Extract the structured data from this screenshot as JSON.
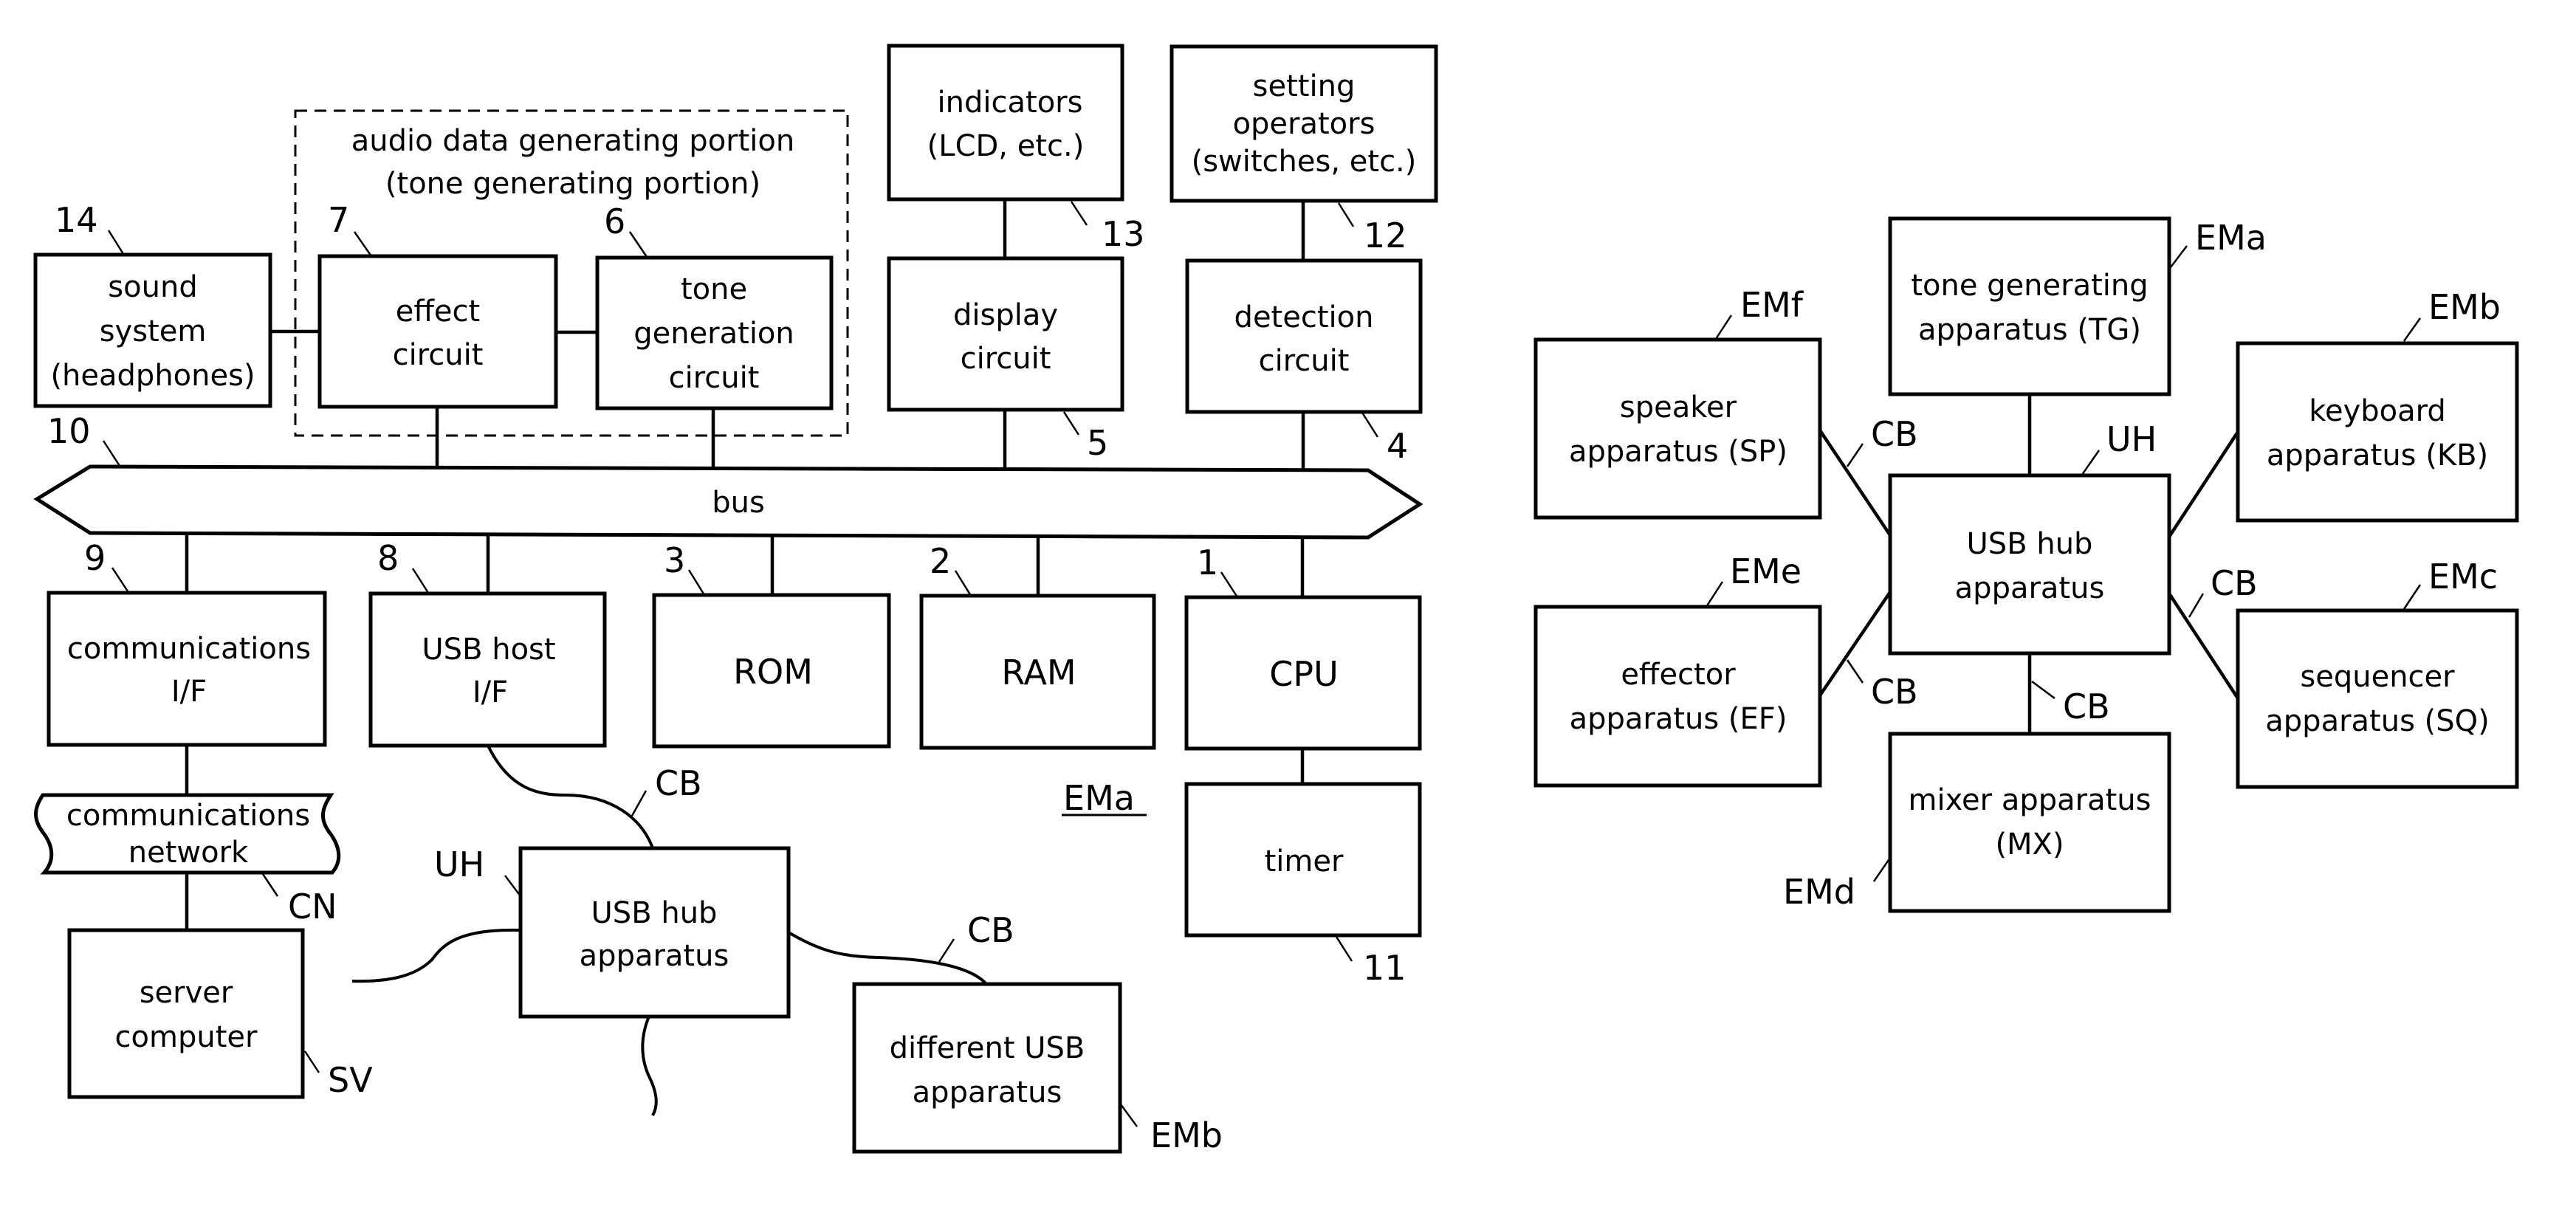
{
  "figure_left": {
    "group_title_line1": "audio data generating portion",
    "group_title_line2": "(tone generating portion)",
    "bus_label": "bus",
    "device_label": "EMa",
    "blocks": {
      "sound_system": [
        "sound",
        "system",
        "(headphones)"
      ],
      "effect_circuit": [
        "effect",
        "circuit"
      ],
      "tone_generation_circuit": [
        "tone",
        "generation",
        "circuit"
      ],
      "indicators": [
        "indicators",
        "(LCD, etc.)"
      ],
      "setting_operators": [
        "setting",
        "operators",
        "(switches, etc.)"
      ],
      "display_circuit": [
        "display",
        "circuit"
      ],
      "detection_circuit": [
        "detection",
        "circuit"
      ],
      "communications_if": [
        "communications",
        "I/F"
      ],
      "usb_host_if": [
        "USB host",
        "I/F"
      ],
      "rom": [
        "ROM"
      ],
      "ram": [
        "RAM"
      ],
      "cpu": [
        "CPU"
      ],
      "timer": [
        "timer"
      ],
      "communications_network": [
        "communications",
        "network"
      ],
      "server_computer": [
        "server",
        "computer"
      ],
      "usb_hub": [
        "USB hub",
        "apparatus"
      ],
      "different_usb": [
        "different USB",
        "apparatus"
      ]
    },
    "refs": {
      "r14": "14",
      "r7": "7",
      "r6": "6",
      "r13": "13",
      "r12": "12",
      "r5": "5",
      "r4": "4",
      "r10": "10",
      "r9": "9",
      "r8": "8",
      "r3": "3",
      "r2": "2",
      "r1": "1",
      "r11": "11",
      "cn": "CN",
      "sv": "SV",
      "uh": "UH",
      "cb1": "CB",
      "cb2": "CB",
      "emb": "EMb"
    }
  },
  "figure_right": {
    "blocks": {
      "tone_generating": [
        "tone generating",
        "apparatus (TG)"
      ],
      "speaker": [
        "speaker",
        "apparatus (SP)"
      ],
      "keyboard": [
        "keyboard",
        "apparatus (KB)"
      ],
      "usb_hub": [
        "USB hub",
        "apparatus"
      ],
      "effector": [
        "effector",
        "apparatus (EF)"
      ],
      "sequencer": [
        "sequencer",
        "apparatus (SQ)"
      ],
      "mixer": [
        "mixer apparatus",
        "(MX)"
      ]
    },
    "refs": {
      "ema": "EMa",
      "emf": "EMf",
      "emb": "EMb",
      "eme": "EMe",
      "emc": "EMc",
      "emd": "EMd",
      "uh": "UH",
      "cb_sp": "CB",
      "cb_ef": "CB",
      "cb_kbsq": "CB",
      "cb_mx": "CB"
    }
  }
}
